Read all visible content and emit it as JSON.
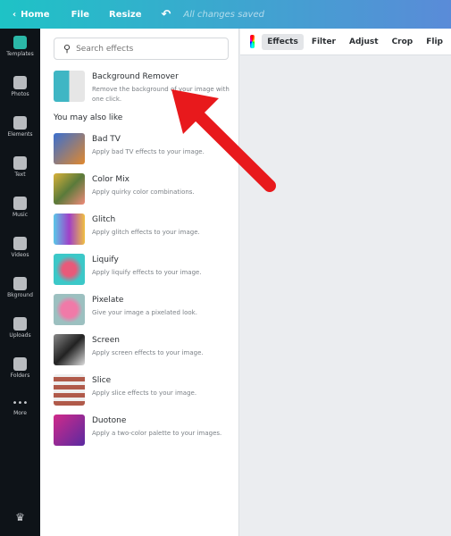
{
  "topbar": {
    "home": "Home",
    "file": "File",
    "resize": "Resize",
    "status": "All changes saved"
  },
  "sidebar": [
    "Templates",
    "Photos",
    "Elements",
    "Text",
    "Music",
    "Videos",
    "Bkground",
    "Uploads",
    "Folders",
    "More"
  ],
  "search": {
    "placeholder": "Search effects"
  },
  "featured": {
    "title": "Background Remover",
    "desc": "Remove the background of your image with one click."
  },
  "section_title": "You may also like",
  "effects": [
    {
      "title": "Bad TV",
      "desc": "Apply bad TV effects to your image."
    },
    {
      "title": "Color Mix",
      "desc": "Apply quirky color combinations."
    },
    {
      "title": "Glitch",
      "desc": "Apply glitch effects to your image."
    },
    {
      "title": "Liquify",
      "desc": "Apply liquify effects to your image."
    },
    {
      "title": "Pixelate",
      "desc": "Give your image a pixelated look."
    },
    {
      "title": "Screen",
      "desc": "Apply screen effects to your image."
    },
    {
      "title": "Slice",
      "desc": "Apply slice effects to your image."
    },
    {
      "title": "Duotone",
      "desc": "Apply a two-color palette to your images."
    }
  ],
  "toolbar": {
    "effects": "Effects",
    "filter": "Filter",
    "adjust": "Adjust",
    "crop": "Crop",
    "flip": "Flip"
  },
  "colors": {
    "arrow": "#e8191c",
    "sidebar": "#0e1318",
    "accent": "#1ec3c6"
  }
}
